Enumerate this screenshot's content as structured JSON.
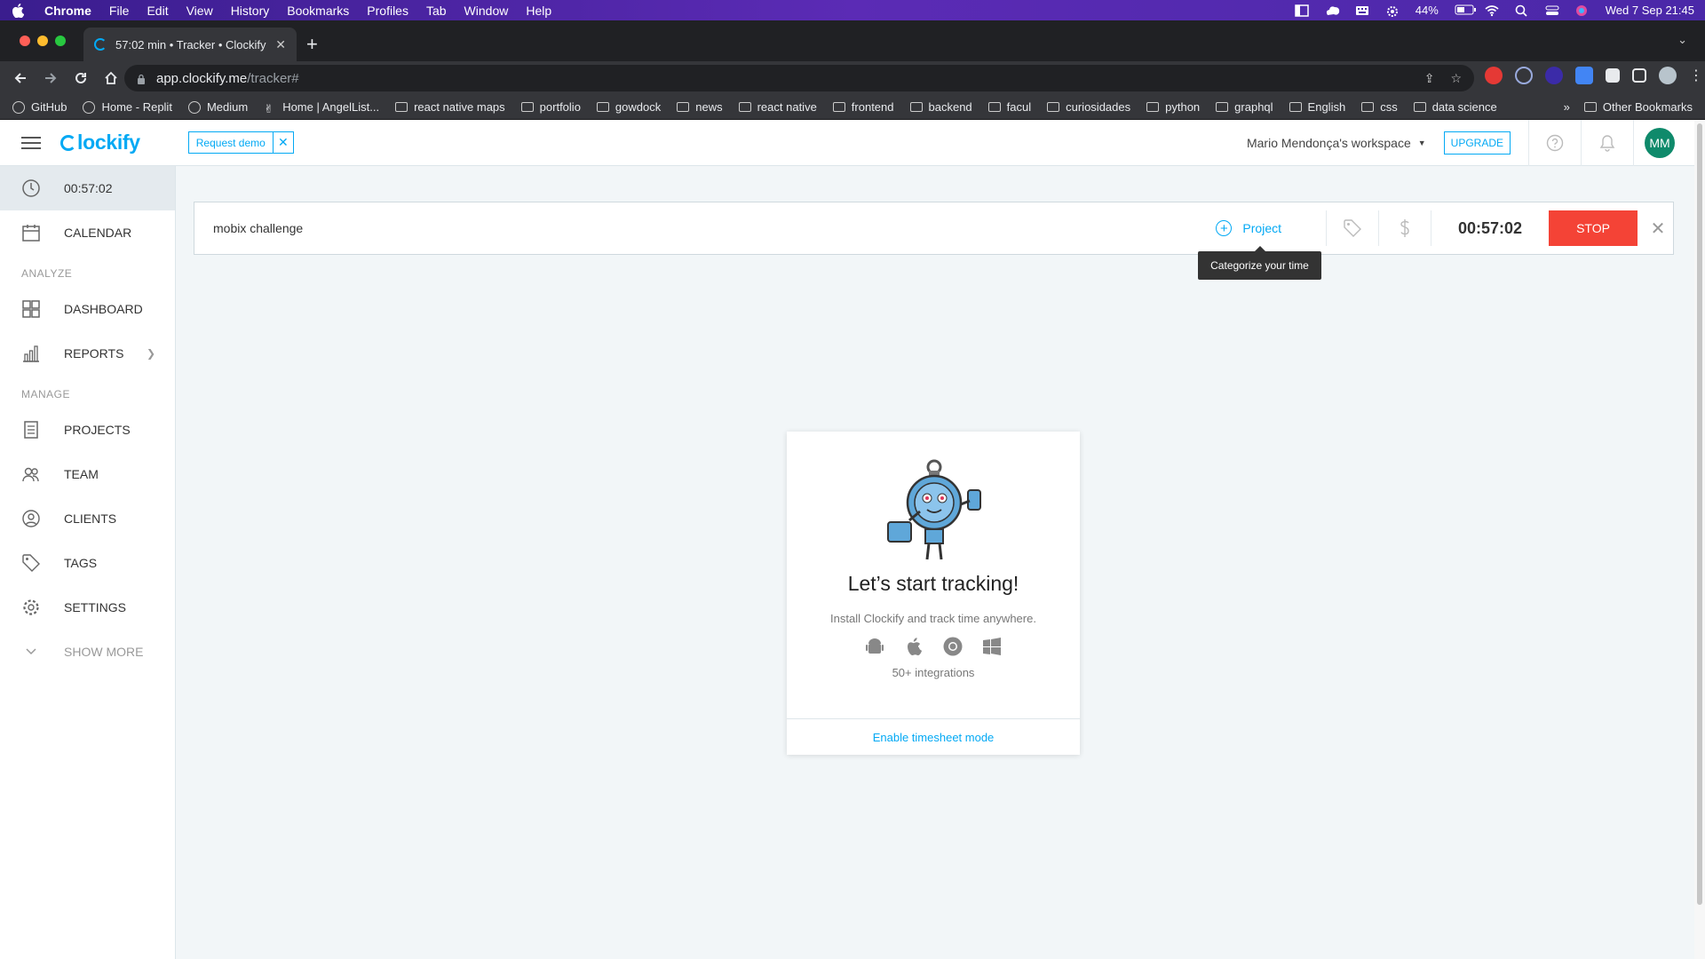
{
  "menubar": {
    "app": "Chrome",
    "items": [
      "File",
      "Edit",
      "View",
      "History",
      "Bookmarks",
      "Profiles",
      "Tab",
      "Window",
      "Help"
    ],
    "battery": "44%",
    "datetime": "Wed 7 Sep  21:45"
  },
  "browser": {
    "tab_title": "57:02 min • Tracker • Clockify",
    "url_host": "app.clockify.me",
    "url_path": "/tracker#",
    "bookmarks": [
      "GitHub",
      "Home - Replit",
      "Medium",
      "Home | AngelList...",
      "react native maps",
      "portfolio",
      "gowdock",
      "news",
      "react native",
      "frontend",
      "backend",
      "facul",
      "curiosidades",
      "python",
      "graphql",
      "English",
      "css",
      "data science"
    ],
    "bookmarks_overflow": "»",
    "other_bookmarks": "Other Bookmarks"
  },
  "header": {
    "logo": "lockify",
    "request_demo": "Request demo",
    "workspace": "Mario Mendonça's workspace",
    "upgrade": "UPGRADE",
    "avatar_initials": "MM"
  },
  "sidebar": {
    "timer": "00:57:02",
    "calendar": "CALENDAR",
    "analyze_heading": "ANALYZE",
    "dashboard": "DASHBOARD",
    "reports": "REPORTS",
    "manage_heading": "MANAGE",
    "projects": "PROJECTS",
    "team": "TEAM",
    "clients": "CLIENTS",
    "tags": "TAGS",
    "settings": "SETTINGS",
    "show_more": "SHOW MORE"
  },
  "tracker": {
    "description": "mobix challenge",
    "project_label": "Project",
    "time": "00:57:02",
    "stop": "STOP",
    "tooltip": "Categorize your time"
  },
  "empty_state": {
    "title": "Let’s start tracking!",
    "subtitle": "Install Clockify and track time anywhere.",
    "integrations": "50+ integrations",
    "footer_link": "Enable timesheet mode"
  },
  "colors": {
    "accent": "#03a9f4",
    "stop": "#f44336",
    "avatar": "#0f8a6b"
  }
}
